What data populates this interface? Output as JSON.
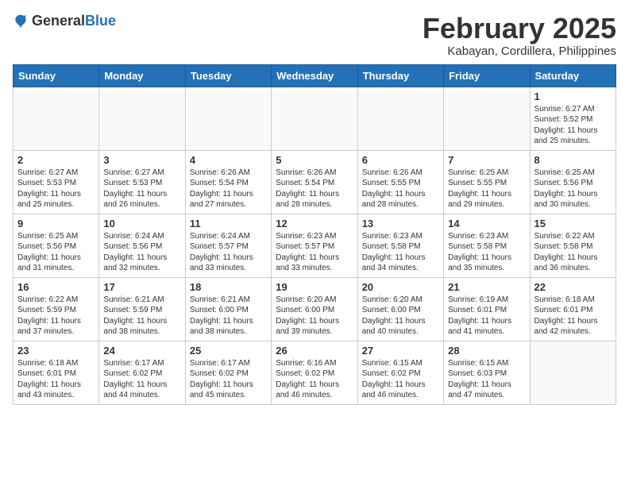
{
  "header": {
    "logo_general": "General",
    "logo_blue": "Blue",
    "month": "February 2025",
    "location": "Kabayan, Cordillera, Philippines"
  },
  "weekdays": [
    "Sunday",
    "Monday",
    "Tuesday",
    "Wednesday",
    "Thursday",
    "Friday",
    "Saturday"
  ],
  "weeks": [
    [
      {
        "day": "",
        "info": ""
      },
      {
        "day": "",
        "info": ""
      },
      {
        "day": "",
        "info": ""
      },
      {
        "day": "",
        "info": ""
      },
      {
        "day": "",
        "info": ""
      },
      {
        "day": "",
        "info": ""
      },
      {
        "day": "1",
        "info": "Sunrise: 6:27 AM\nSunset: 5:52 PM\nDaylight: 11 hours\nand 25 minutes."
      }
    ],
    [
      {
        "day": "2",
        "info": "Sunrise: 6:27 AM\nSunset: 5:53 PM\nDaylight: 11 hours\nand 25 minutes."
      },
      {
        "day": "3",
        "info": "Sunrise: 6:27 AM\nSunset: 5:53 PM\nDaylight: 11 hours\nand 26 minutes."
      },
      {
        "day": "4",
        "info": "Sunrise: 6:26 AM\nSunset: 5:54 PM\nDaylight: 11 hours\nand 27 minutes."
      },
      {
        "day": "5",
        "info": "Sunrise: 6:26 AM\nSunset: 5:54 PM\nDaylight: 11 hours\nand 28 minutes."
      },
      {
        "day": "6",
        "info": "Sunrise: 6:26 AM\nSunset: 5:55 PM\nDaylight: 11 hours\nand 28 minutes."
      },
      {
        "day": "7",
        "info": "Sunrise: 6:25 AM\nSunset: 5:55 PM\nDaylight: 11 hours\nand 29 minutes."
      },
      {
        "day": "8",
        "info": "Sunrise: 6:25 AM\nSunset: 5:56 PM\nDaylight: 11 hours\nand 30 minutes."
      }
    ],
    [
      {
        "day": "9",
        "info": "Sunrise: 6:25 AM\nSunset: 5:56 PM\nDaylight: 11 hours\nand 31 minutes."
      },
      {
        "day": "10",
        "info": "Sunrise: 6:24 AM\nSunset: 5:56 PM\nDaylight: 11 hours\nand 32 minutes."
      },
      {
        "day": "11",
        "info": "Sunrise: 6:24 AM\nSunset: 5:57 PM\nDaylight: 11 hours\nand 33 minutes."
      },
      {
        "day": "12",
        "info": "Sunrise: 6:23 AM\nSunset: 5:57 PM\nDaylight: 11 hours\nand 33 minutes."
      },
      {
        "day": "13",
        "info": "Sunrise: 6:23 AM\nSunset: 5:58 PM\nDaylight: 11 hours\nand 34 minutes."
      },
      {
        "day": "14",
        "info": "Sunrise: 6:23 AM\nSunset: 5:58 PM\nDaylight: 11 hours\nand 35 minutes."
      },
      {
        "day": "15",
        "info": "Sunrise: 6:22 AM\nSunset: 5:58 PM\nDaylight: 11 hours\nand 36 minutes."
      }
    ],
    [
      {
        "day": "16",
        "info": "Sunrise: 6:22 AM\nSunset: 5:59 PM\nDaylight: 11 hours\nand 37 minutes."
      },
      {
        "day": "17",
        "info": "Sunrise: 6:21 AM\nSunset: 5:59 PM\nDaylight: 11 hours\nand 38 minutes."
      },
      {
        "day": "18",
        "info": "Sunrise: 6:21 AM\nSunset: 6:00 PM\nDaylight: 11 hours\nand 38 minutes."
      },
      {
        "day": "19",
        "info": "Sunrise: 6:20 AM\nSunset: 6:00 PM\nDaylight: 11 hours\nand 39 minutes."
      },
      {
        "day": "20",
        "info": "Sunrise: 6:20 AM\nSunset: 6:00 PM\nDaylight: 11 hours\nand 40 minutes."
      },
      {
        "day": "21",
        "info": "Sunrise: 6:19 AM\nSunset: 6:01 PM\nDaylight: 11 hours\nand 41 minutes."
      },
      {
        "day": "22",
        "info": "Sunrise: 6:18 AM\nSunset: 6:01 PM\nDaylight: 11 hours\nand 42 minutes."
      }
    ],
    [
      {
        "day": "23",
        "info": "Sunrise: 6:18 AM\nSunset: 6:01 PM\nDaylight: 11 hours\nand 43 minutes."
      },
      {
        "day": "24",
        "info": "Sunrise: 6:17 AM\nSunset: 6:02 PM\nDaylight: 11 hours\nand 44 minutes."
      },
      {
        "day": "25",
        "info": "Sunrise: 6:17 AM\nSunset: 6:02 PM\nDaylight: 11 hours\nand 45 minutes."
      },
      {
        "day": "26",
        "info": "Sunrise: 6:16 AM\nSunset: 6:02 PM\nDaylight: 11 hours\nand 46 minutes."
      },
      {
        "day": "27",
        "info": "Sunrise: 6:15 AM\nSunset: 6:02 PM\nDaylight: 11 hours\nand 46 minutes."
      },
      {
        "day": "28",
        "info": "Sunrise: 6:15 AM\nSunset: 6:03 PM\nDaylight: 11 hours\nand 47 minutes."
      },
      {
        "day": "",
        "info": ""
      }
    ]
  ]
}
